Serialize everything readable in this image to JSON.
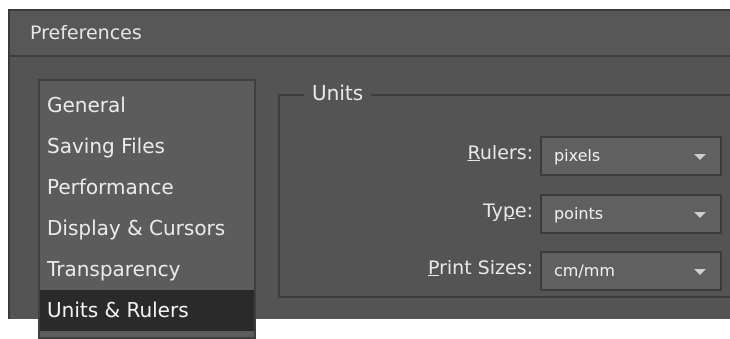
{
  "window": {
    "title": "Preferences"
  },
  "sidebar": {
    "items": [
      {
        "label": "General"
      },
      {
        "label": "Saving Files"
      },
      {
        "label": "Performance"
      },
      {
        "label": "Display & Cursors"
      },
      {
        "label": "Transparency"
      },
      {
        "label": "Units & Rulers",
        "selected": true
      }
    ]
  },
  "units_group": {
    "title": "Units",
    "rulers": {
      "mnemonic": "R",
      "label_rest": "ulers:",
      "value": "pixels"
    },
    "type": {
      "label_pre": "Ty",
      "mnemonic": "p",
      "label_rest": "e:",
      "value": "points"
    },
    "print_sizes": {
      "mnemonic": "P",
      "label_rest": "rint Sizes:",
      "value": "cm/mm"
    }
  }
}
